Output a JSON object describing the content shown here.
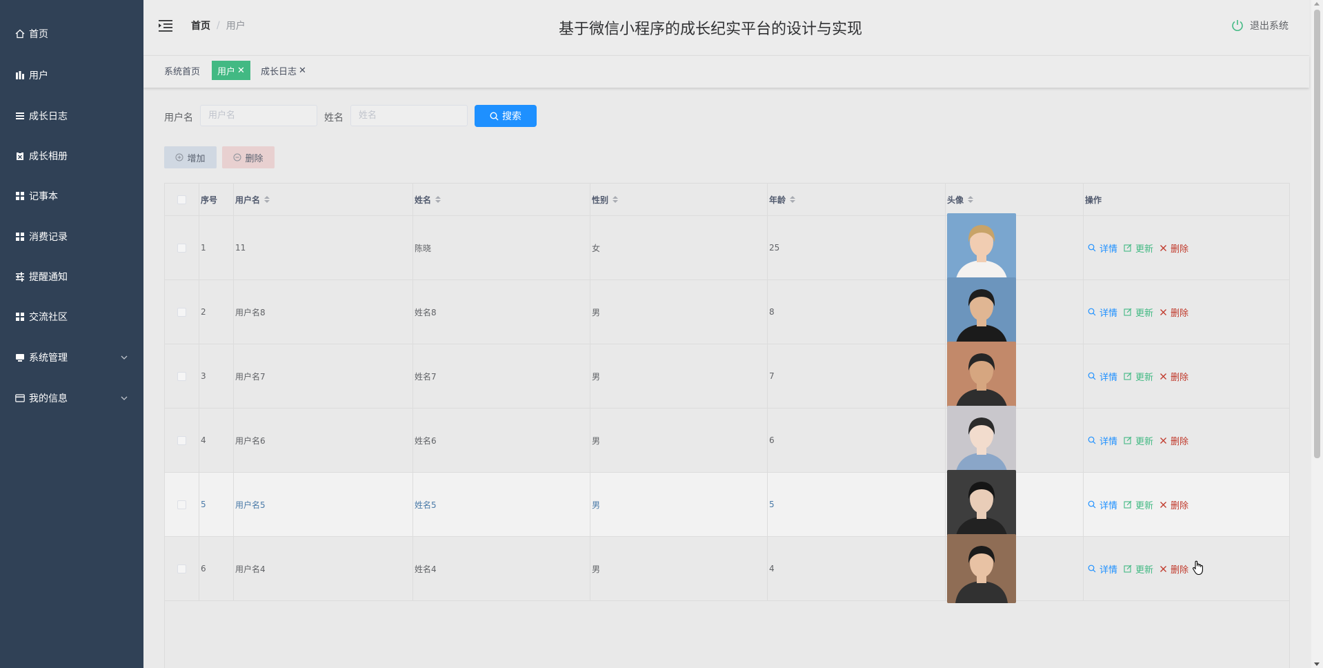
{
  "app": {
    "title": "基于微信小程序的成长纪实平台的设计与实现",
    "logout_label": "退出系统"
  },
  "sidebar": {
    "items": [
      {
        "label": "首页",
        "icon": "home-icon"
      },
      {
        "label": "用户",
        "icon": "bar-icon"
      },
      {
        "label": "成长日志",
        "icon": "list-icon"
      },
      {
        "label": "成长相册",
        "icon": "clipboard-icon"
      },
      {
        "label": "记事本",
        "icon": "grid-icon"
      },
      {
        "label": "消费记录",
        "icon": "grid-icon"
      },
      {
        "label": "提醒通知",
        "icon": "sliders-icon"
      },
      {
        "label": "交流社区",
        "icon": "grid-icon"
      },
      {
        "label": "系统管理",
        "icon": "monitor-icon"
      },
      {
        "label": "我的信息",
        "icon": "card-icon"
      }
    ]
  },
  "breadcrumb": {
    "home": "首页",
    "separator": "/",
    "current": "用户"
  },
  "tags": [
    {
      "label": "系统首页"
    },
    {
      "label": "用户",
      "close": "✕"
    },
    {
      "label": "成长日志",
      "close": "✕"
    }
  ],
  "filters": {
    "username_label": "用户名",
    "username_placeholder": "用户名",
    "name_label": "姓名",
    "name_placeholder": "姓名",
    "search_label": "搜索"
  },
  "actions": {
    "add_label": "增加",
    "delete_label": "删除"
  },
  "table": {
    "headers": [
      "序号",
      "用户名",
      "姓名",
      "性别",
      "年龄",
      "头像",
      "操作"
    ],
    "op_labels": {
      "detail": "详情",
      "update": "更新",
      "delete": "删除"
    },
    "rows": [
      {
        "index": "1",
        "username": "11",
        "name": "陈晓",
        "gender": "女",
        "age": "25"
      },
      {
        "index": "2",
        "username": "用户名8",
        "name": "姓名8",
        "gender": "男",
        "age": "8"
      },
      {
        "index": "3",
        "username": "用户名7",
        "name": "姓名7",
        "gender": "男",
        "age": "7"
      },
      {
        "index": "4",
        "username": "用户名6",
        "name": "姓名6",
        "gender": "男",
        "age": "6"
      },
      {
        "index": "5",
        "username": "用户名5",
        "name": "姓名5",
        "gender": "男",
        "age": "5"
      },
      {
        "index": "6",
        "username": "用户名4",
        "name": "姓名4",
        "gender": "男",
        "age": "4"
      }
    ]
  },
  "colors": {
    "sidebar": "#304156",
    "accent": "#42b983",
    "primary": "#1e90ff",
    "danger": "#c0392b"
  }
}
